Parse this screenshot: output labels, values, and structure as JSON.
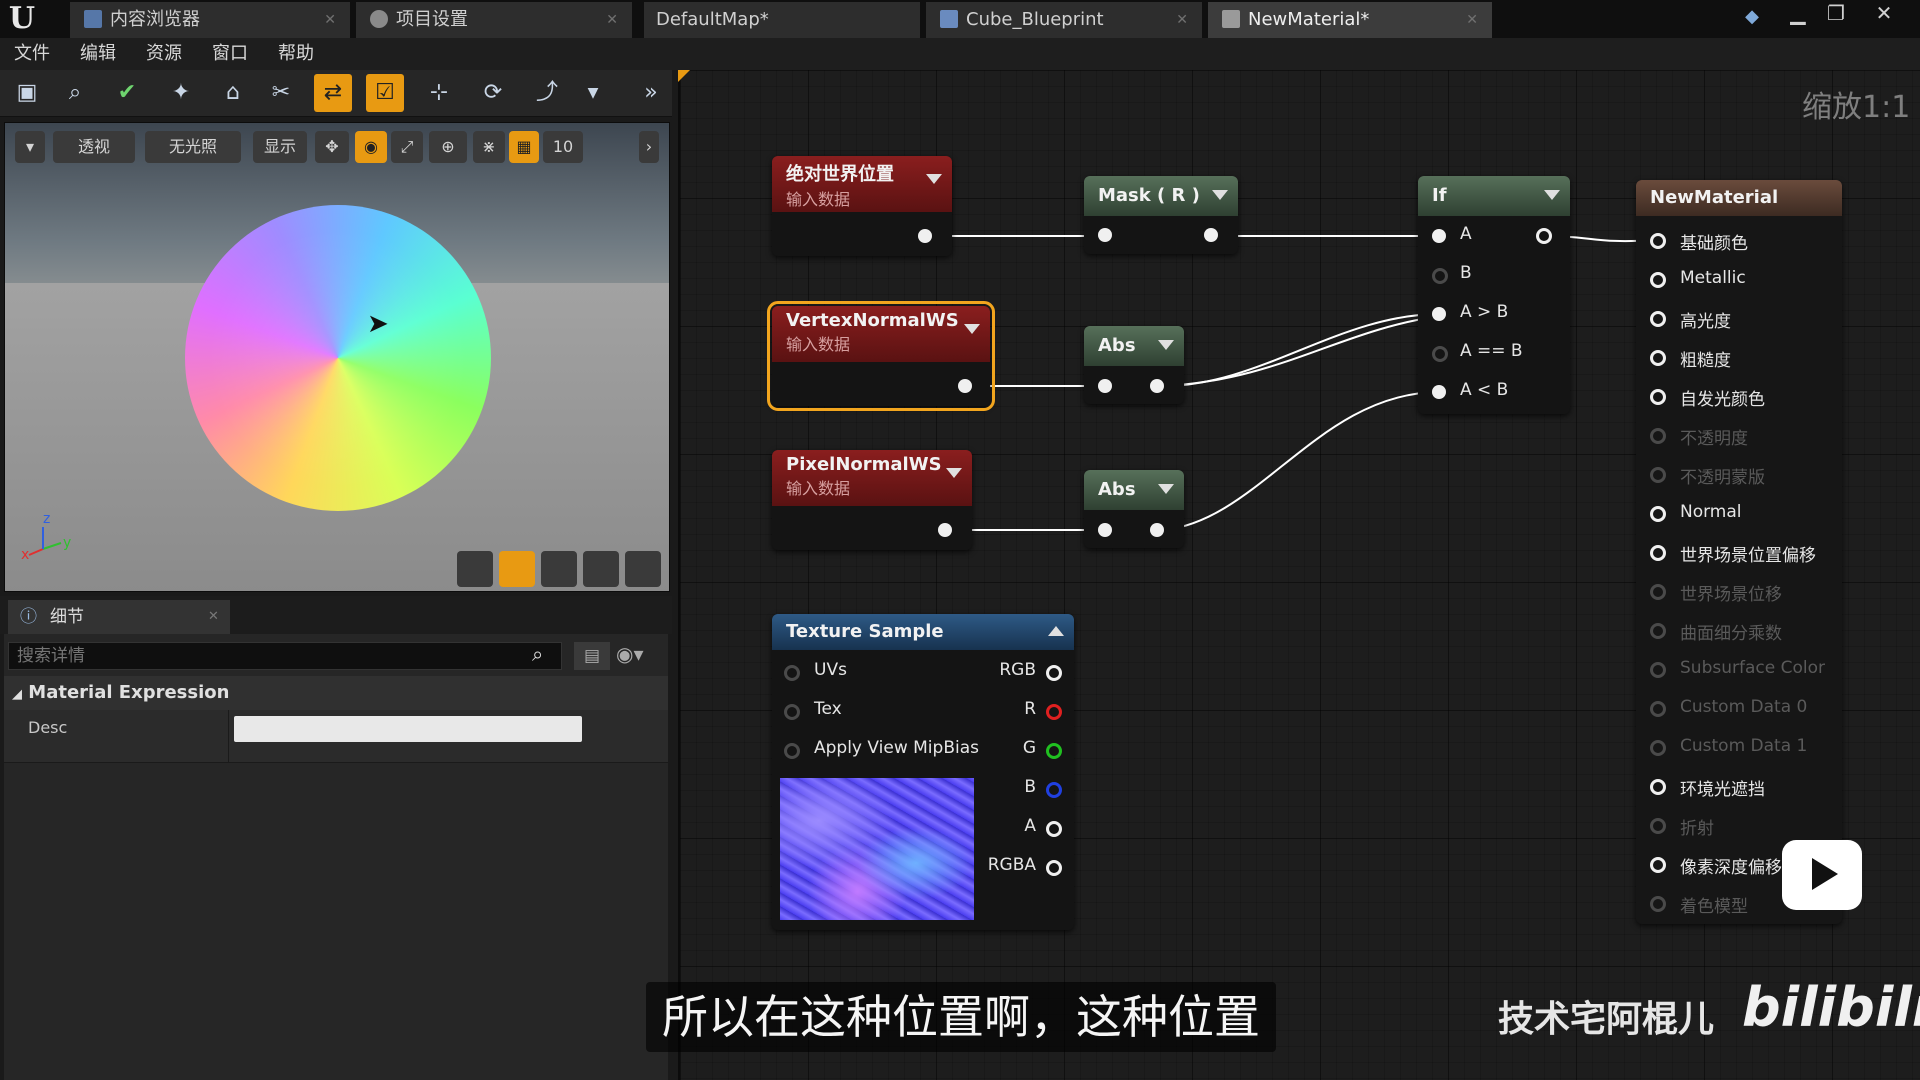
{
  "tabs": [
    {
      "label": "内容浏览器",
      "icon": "content-browser-icon"
    },
    {
      "label": "项目设置",
      "icon": "settings-icon"
    },
    {
      "label": "DefaultMap*",
      "icon": ""
    },
    {
      "label": "Cube_Blueprint",
      "icon": "blueprint-icon"
    },
    {
      "label": "NewMaterial*",
      "icon": "material-icon"
    }
  ],
  "menu": [
    "文件",
    "编辑",
    "资源",
    "窗口",
    "帮助"
  ],
  "viewport": {
    "perspective": "透视",
    "lighting": "无光照",
    "show": "显示",
    "grid_value": "10"
  },
  "details": {
    "tab": "细节",
    "search_placeholder": "搜索详情",
    "section": "Material Expression",
    "desc_label": "Desc"
  },
  "graph": {
    "zoom": "缩放1:1",
    "nodes": {
      "abs_world_pos": {
        "title": "绝对世界位置",
        "sub": "输入数据"
      },
      "mask": {
        "title": "Mask ( R )"
      },
      "if": {
        "title": "If",
        "inputs": [
          "A",
          "B",
          "A > B",
          "A == B",
          "A < B"
        ]
      },
      "vertex_normal": {
        "title": "VertexNormalWS",
        "sub": "输入数据"
      },
      "abs1": {
        "title": "Abs"
      },
      "pixel_normal": {
        "title": "PixelNormalWS",
        "sub": "输入数据"
      },
      "abs2": {
        "title": "Abs"
      },
      "texture_sample": {
        "title": "Texture Sample",
        "inputs": [
          "UVs",
          "Tex",
          "Apply View MipBias"
        ],
        "outputs": [
          "RGB",
          "R",
          "G",
          "B",
          "A",
          "RGBA"
        ],
        "output_colors": [
          "#f0f0f0",
          "#e02020",
          "#20c020",
          "#2040e0",
          "#f0f0f0",
          "#f0f0f0"
        ]
      },
      "material": {
        "title": "NewMaterial",
        "pins": [
          {
            "label": "基础颜色",
            "active": true
          },
          {
            "label": "Metallic",
            "active": true
          },
          {
            "label": "高光度",
            "active": true
          },
          {
            "label": "粗糙度",
            "active": true
          },
          {
            "label": "自发光颜色",
            "active": true
          },
          {
            "label": "不透明度",
            "active": false
          },
          {
            "label": "不透明蒙版",
            "active": false
          },
          {
            "label": "Normal",
            "active": true
          },
          {
            "label": "世界场景位置偏移",
            "active": true
          },
          {
            "label": "世界场景位移",
            "active": false
          },
          {
            "label": "曲面细分乘数",
            "active": false
          },
          {
            "label": "Subsurface Color",
            "active": false
          },
          {
            "label": "Custom Data 0",
            "active": false
          },
          {
            "label": "Custom Data 1",
            "active": false
          },
          {
            "label": "环境光遮挡",
            "active": true
          },
          {
            "label": "折射",
            "active": false
          },
          {
            "label": "像素深度偏移",
            "active": true
          },
          {
            "label": "着色模型",
            "active": false
          }
        ]
      }
    }
  },
  "overlay": {
    "subtitle": "所以在这种位置啊，这种位置",
    "watermark": "技术宅阿棍儿",
    "logo": "bilibili"
  }
}
